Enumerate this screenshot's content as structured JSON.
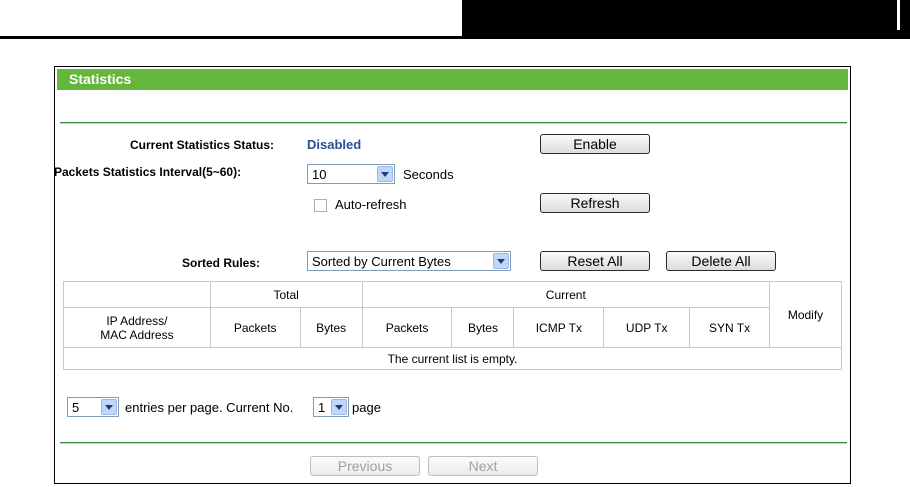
{
  "header": {
    "title": "Statistics"
  },
  "status": {
    "label": "Current Statistics Status:",
    "value": "Disabled",
    "enable_button": "Enable"
  },
  "interval": {
    "label": "Packets Statistics Interval(5~60):",
    "value": "10",
    "unit": "Seconds",
    "auto_refresh_label": "Auto-refresh",
    "auto_refresh_checked": false,
    "refresh_button": "Refresh"
  },
  "sorting": {
    "label": "Sorted Rules:",
    "value": "Sorted by Current Bytes",
    "reset_all_button": "Reset All",
    "delete_all_button": "Delete All"
  },
  "table": {
    "group_total": "Total",
    "group_current": "Current",
    "col_ip_mac_line1": "IP Address/",
    "col_ip_mac_line2": "MAC Address",
    "col_total_packets": "Packets",
    "col_total_bytes": "Bytes",
    "col_current_packets": "Packets",
    "col_current_bytes": "Bytes",
    "col_icmp": "ICMP Tx",
    "col_udp": "UDP Tx",
    "col_syn": "SYN Tx",
    "col_modify": "Modify",
    "empty_message": "The current list is empty."
  },
  "pagination": {
    "entries_value": "5",
    "entries_label": "entries per page.  Current No.",
    "page_value": "1",
    "page_label": "page",
    "previous_button": "Previous",
    "next_button": "Next"
  },
  "colors": {
    "accent": "#64b63c",
    "status": "#2a4f93"
  }
}
